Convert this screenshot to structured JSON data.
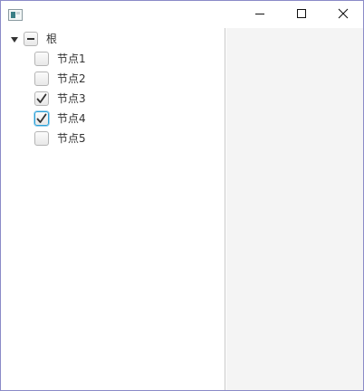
{
  "window": {
    "controls": {
      "minimize": "minimize-icon",
      "maximize": "maximize-icon",
      "close": "close-icon"
    }
  },
  "tree": {
    "root": {
      "label": "根",
      "expanded": true,
      "state": "indeterminate"
    },
    "children": [
      {
        "label": "节点1",
        "checked": false
      },
      {
        "label": "节点2",
        "checked": false
      },
      {
        "label": "节点3",
        "checked": true
      },
      {
        "label": "节点4",
        "checked": true,
        "focused": true
      },
      {
        "label": "节点5",
        "checked": false
      }
    ]
  },
  "colors": {
    "focus_ring": "#2a9fd6",
    "window_border": "#8b8bc8",
    "right_pane": "#f4f4f4"
  }
}
